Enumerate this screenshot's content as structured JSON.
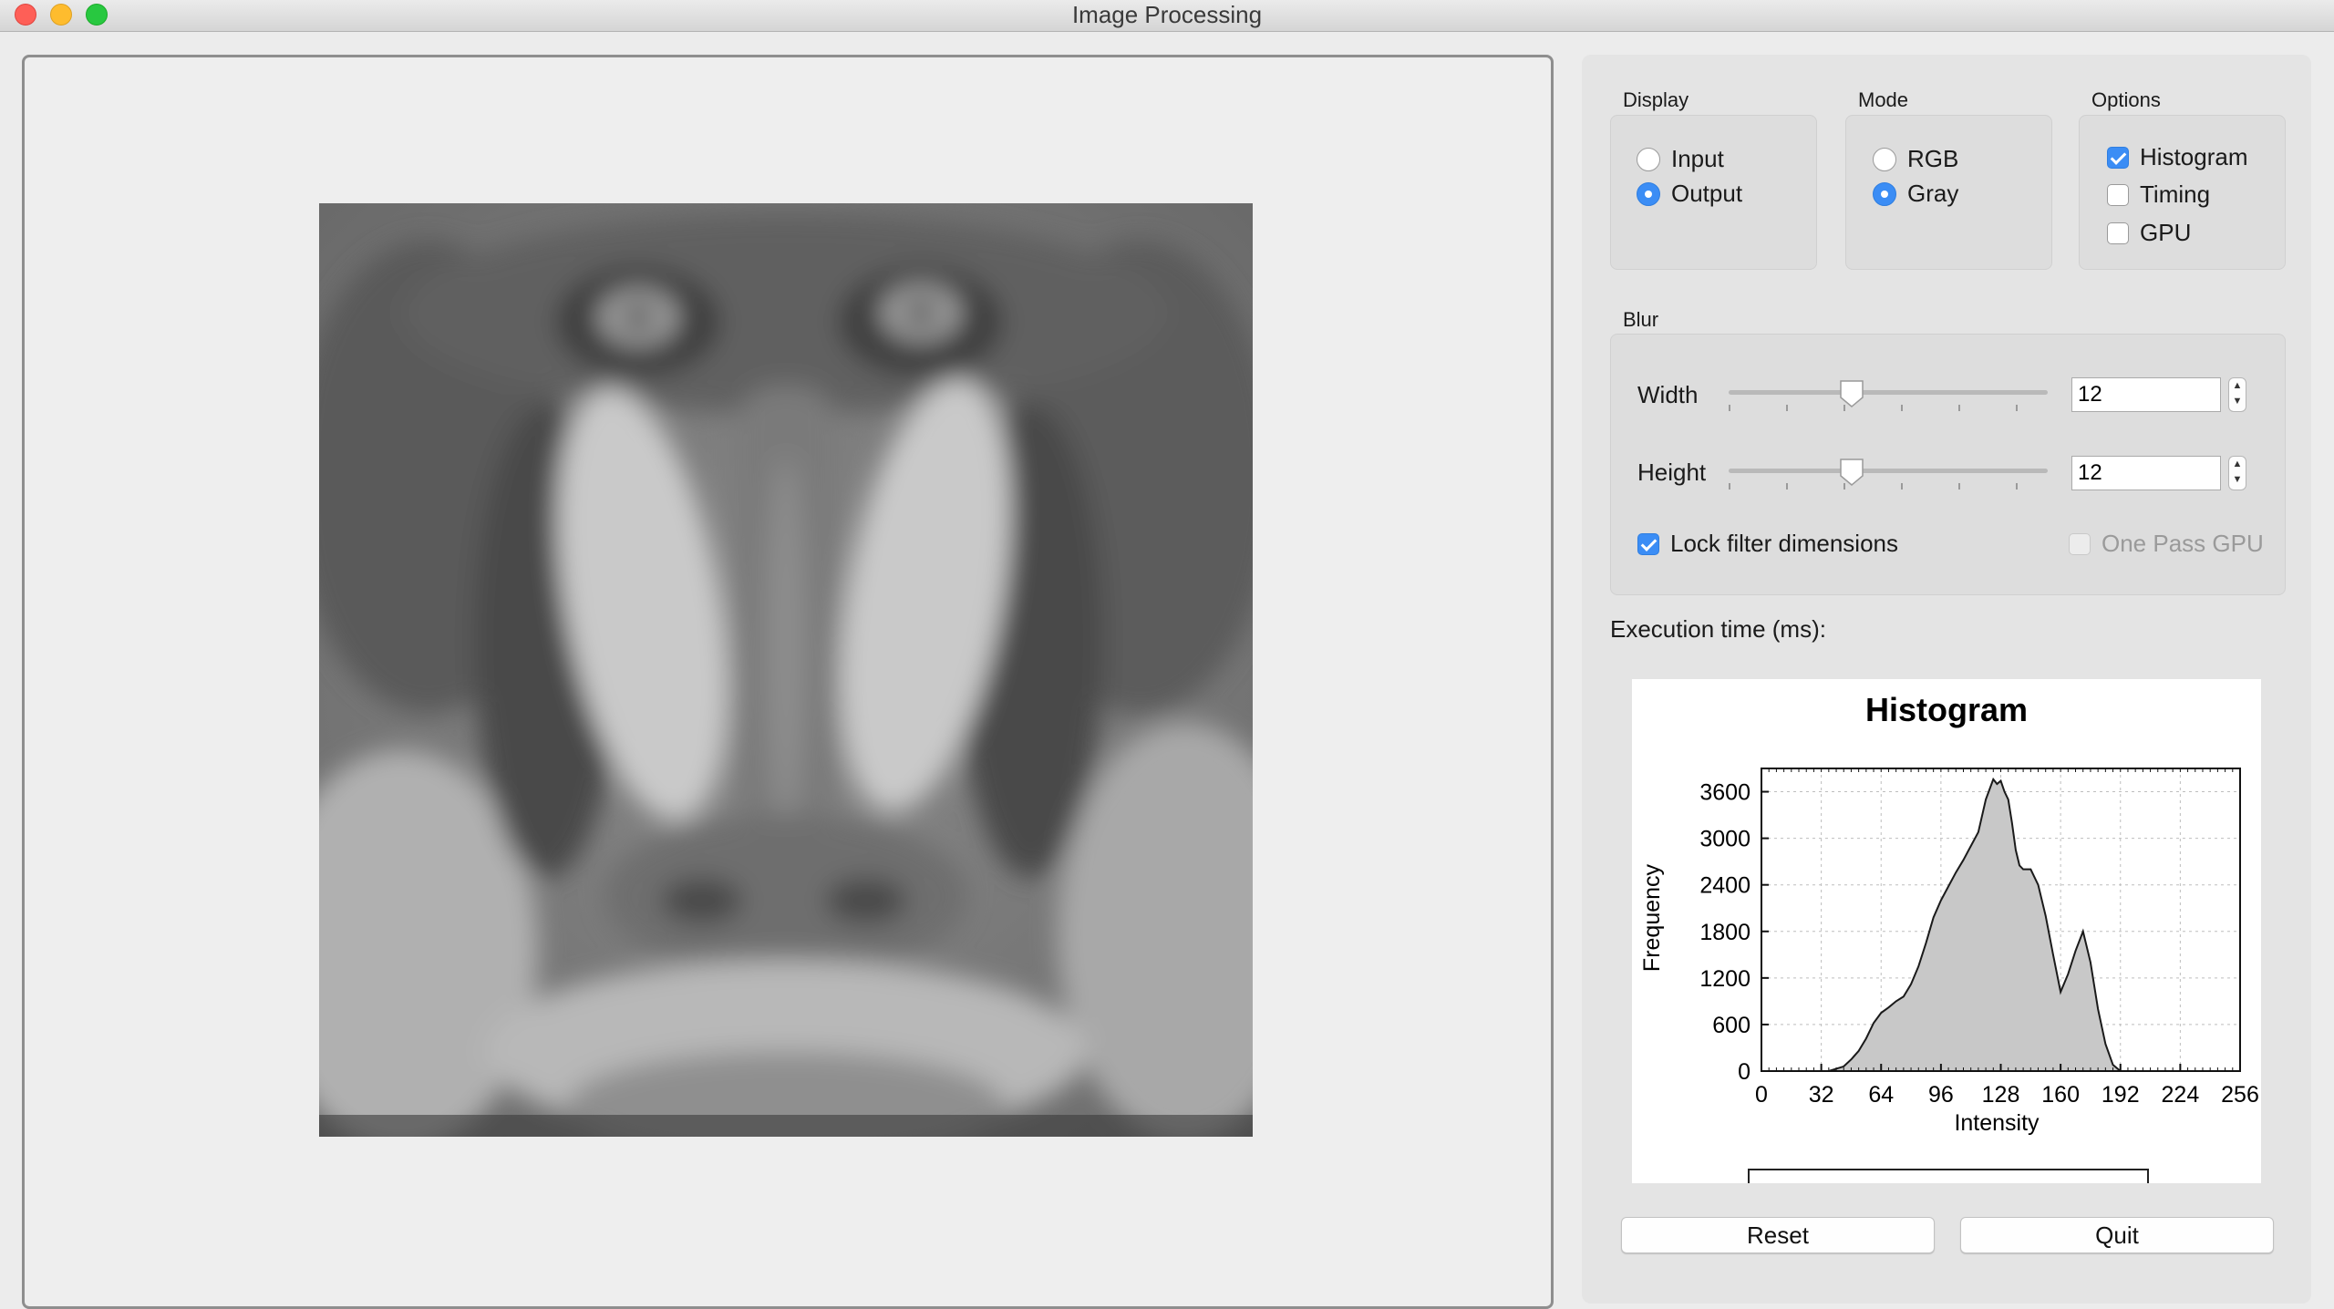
{
  "window": {
    "title": "Image Processing"
  },
  "display": {
    "title": "Display",
    "options": [
      {
        "label": "Input",
        "selected": false
      },
      {
        "label": "Output",
        "selected": true
      }
    ]
  },
  "mode": {
    "title": "Mode",
    "options": [
      {
        "label": "RGB",
        "selected": false
      },
      {
        "label": "Gray",
        "selected": true
      }
    ]
  },
  "options": {
    "title": "Options",
    "items": [
      {
        "label": "Histogram",
        "checked": true
      },
      {
        "label": "Timing",
        "checked": false
      },
      {
        "label": "GPU",
        "checked": false
      }
    ]
  },
  "blur": {
    "title": "Blur",
    "width_label": "Width",
    "width_value": "12",
    "height_label": "Height",
    "height_value": "12",
    "lock_label": "Lock filter dimensions",
    "lock_checked": true,
    "one_pass_label": "One Pass GPU",
    "one_pass_checked": false,
    "one_pass_enabled": false
  },
  "execution_time_label": "Execution time (ms):",
  "buttons": {
    "reset": "Reset",
    "quit": "Quit"
  },
  "colors": {
    "accent": "#3b8df5",
    "histogram_fill": "#c8c8c8",
    "histogram_line": "#1a1a1a"
  },
  "chart_data": {
    "type": "area",
    "title": "Histogram",
    "xlabel": "Intensity",
    "ylabel": "Frequency",
    "xlim": [
      0,
      256
    ],
    "ylim": [
      0,
      3900
    ],
    "x_ticks": [
      0,
      32,
      64,
      96,
      128,
      160,
      192,
      224,
      256
    ],
    "y_ticks": [
      0,
      600,
      1200,
      1800,
      2400,
      3000,
      3600
    ],
    "grid": true,
    "x": [
      36,
      44,
      48,
      52,
      56,
      60,
      64,
      68,
      72,
      76,
      80,
      84,
      88,
      92,
      96,
      100,
      104,
      108,
      112,
      116,
      120,
      124,
      126,
      128,
      130,
      132,
      134,
      136,
      138,
      140,
      144,
      148,
      152,
      156,
      160,
      164,
      168,
      172,
      176,
      178,
      180,
      184,
      188,
      192
    ],
    "values": [
      0,
      60,
      150,
      260,
      420,
      620,
      750,
      820,
      900,
      960,
      1120,
      1350,
      1650,
      1980,
      2200,
      2380,
      2560,
      2720,
      2900,
      3080,
      3500,
      3760,
      3700,
      3740,
      3600,
      3500,
      3200,
      2850,
      2650,
      2600,
      2600,
      2400,
      2000,
      1500,
      1020,
      1250,
      1550,
      1800,
      1400,
      1100,
      800,
      350,
      80,
      0
    ]
  }
}
